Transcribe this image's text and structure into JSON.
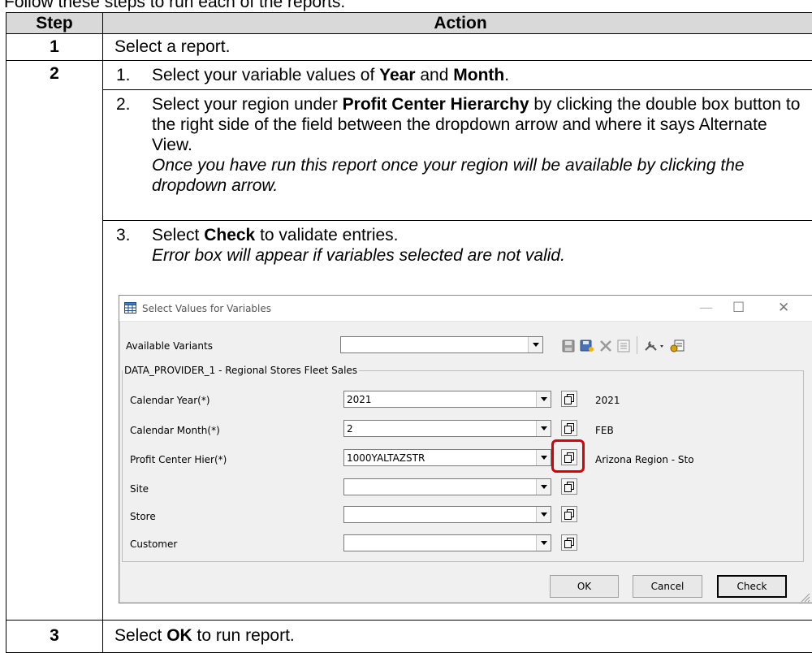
{
  "intro": "Follow these steps to run each of the reports.",
  "table": {
    "headers": [
      "Step",
      "Action"
    ],
    "rows": [
      {
        "step": "1",
        "text": "Select a report."
      },
      {
        "step": "2"
      },
      {
        "step": "3",
        "text_pre": "Select ",
        "text_bold": "OK",
        "text_post": " to run report."
      }
    ],
    "substeps": [
      {
        "num": "1.",
        "pre": "Select your variable values of ",
        "b1": "Year",
        "mid": " and ",
        "b2": "Month",
        "post": "."
      },
      {
        "num": "2.",
        "pre": "Select your region under ",
        "b1": "Profit Center Hierarchy",
        "post": " by clicking the double box button to the right side of the field between the dropdown arrow and where it says Alternate View.",
        "italic": "Once you have run this report once your region will be available by clicking the dropdown arrow."
      },
      {
        "num": "3.",
        "pre": "Select ",
        "b1": "Check",
        "post": " to validate entries.",
        "italic": "Error box will appear if variables selected are not valid."
      }
    ]
  },
  "dialog": {
    "title": "Select Values for Variables",
    "available_variants_label": "Available Variants",
    "available_variants_value": "",
    "group_label": "DATA_PROVIDER_1 - Regional Stores Fleet Sales",
    "fields": [
      {
        "label": "Calendar Year(*)",
        "value": "2021",
        "desc": "2021"
      },
      {
        "label": "Calendar Month(*)",
        "value": "2",
        "desc": "FEB"
      },
      {
        "label": "Profit Center Hier(*)",
        "value": "1000YALTAZSTR",
        "desc": "Arizona Region - Sto"
      },
      {
        "label": "Site",
        "value": "",
        "desc": ""
      },
      {
        "label": "Store",
        "value": "",
        "desc": ""
      },
      {
        "label": "Customer",
        "value": "",
        "desc": ""
      }
    ],
    "buttons": {
      "ok": "OK",
      "cancel": "Cancel",
      "check": "Check"
    },
    "window_controls": {
      "minimize": "—",
      "maximize": "☐",
      "close": "✕"
    }
  }
}
